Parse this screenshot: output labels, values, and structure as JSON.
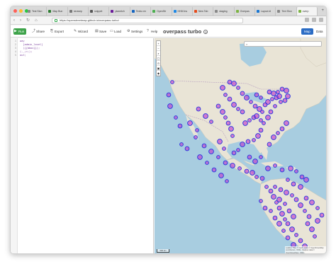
{
  "browser": {
    "tabs": [
      {
        "label": "Test Slon",
        "color": "#888888"
      },
      {
        "label": "Map Bun",
        "color": "#2e7d32"
      },
      {
        "label": "neowep",
        "color": "#777777"
      },
      {
        "label": "snippet",
        "color": "#555555"
      },
      {
        "label": "planetch",
        "color": "#6a1b9a"
      },
      {
        "label": "Texbo en",
        "color": "#1565c0"
      },
      {
        "label": "OpenStr",
        "color": "#4caf50"
      },
      {
        "label": "HHM Ins",
        "color": "#1e88e5"
      },
      {
        "label": "New Tab",
        "color": "#e64a19"
      },
      {
        "label": "staging",
        "color": "#888888"
      },
      {
        "label": "Overpas",
        "color": "#7cb342"
      },
      {
        "label": "Layout di",
        "color": "#1976d2"
      },
      {
        "label": "Text Slon",
        "color": "#888888"
      },
      {
        "label": "overp",
        "color": "#7cb342",
        "active": true
      }
    ],
    "url": "https://openstreetmap.github.io/overpass-turbo/",
    "traffic_lights": [
      "#ff5f57",
      "#febc2e",
      "#28c840"
    ]
  },
  "app": {
    "buttons": {
      "run": "Run",
      "share": "Share",
      "export": "Export",
      "wizard": "Wizard",
      "save": "Save",
      "load": "Load",
      "settings": "Settings",
      "help": "Help"
    },
    "title": "overpass turbo",
    "tab_map": "Map",
    "tab_data": "Data",
    "accent": "#2b6cc4",
    "run_color": "#3ea34a"
  },
  "editor": {
    "lines": [
      {
        "num": "1",
        "text": "way"
      },
      {
        "num": "2",
        "text": "  [admin_level]"
      },
      {
        "num": "3",
        "text": "  ({{bbox}});"
      },
      {
        "num": "4",
        "text": "(._;>;);"
      },
      {
        "num": "5",
        "text": "out;"
      }
    ]
  },
  "map": {
    "controls": [
      "+",
      "−",
      "⌕",
      "▢",
      "⊙",
      "▣",
      "◆"
    ],
    "scale": "500 km",
    "attribution": "Leaflet | Tiles © Carto, Data © OpenStreetMap contributors, ODbL. Mapbox data © OpenStreetMap, ODbL",
    "marker_fill": "#c034c8",
    "marker_stroke": "#2434e0"
  }
}
